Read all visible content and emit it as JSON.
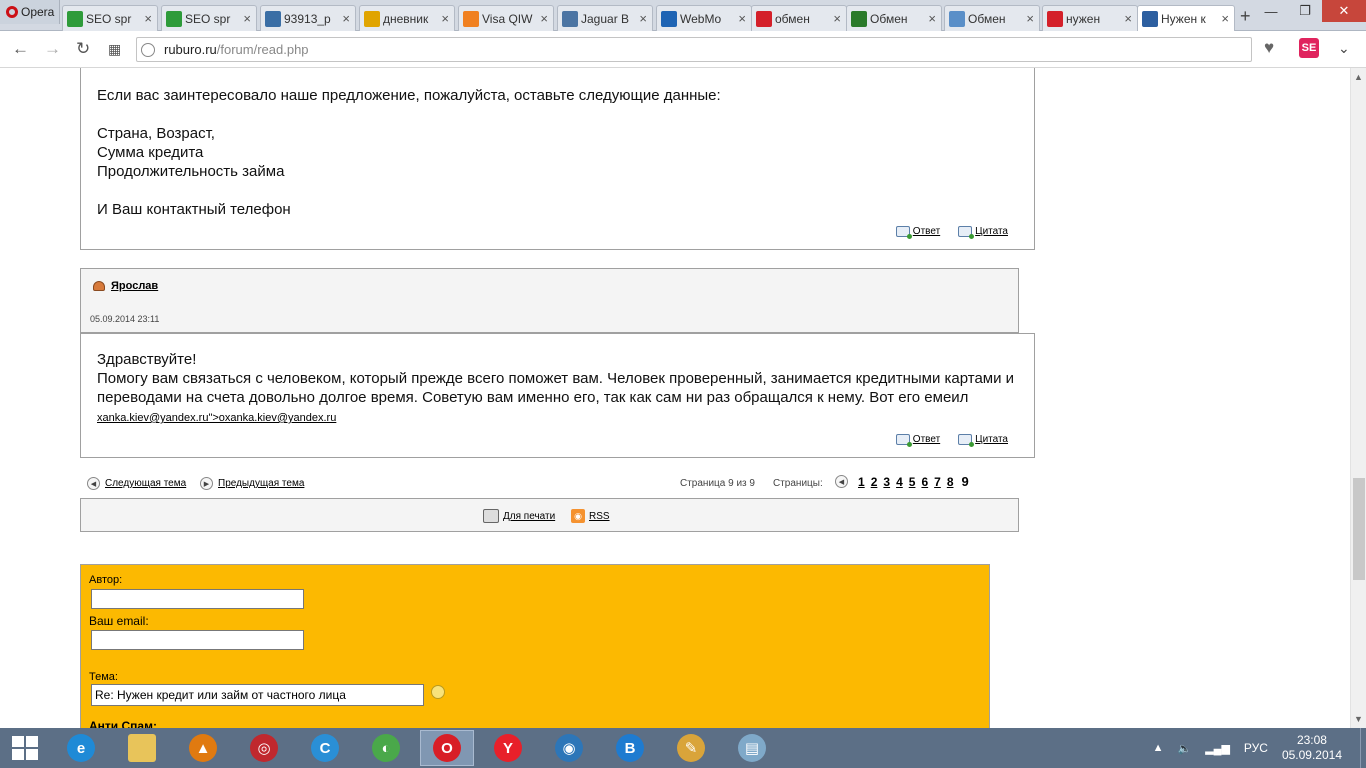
{
  "browser": {
    "menu_label": "Opera",
    "tabs": [
      {
        "label": "SEO spr",
        "icon": "seo-sprint-icon",
        "color": "#2e9b3a"
      },
      {
        "label": "SEO spr",
        "icon": "seo-sprint-icon",
        "color": "#2e9b3a"
      },
      {
        "label": "93913_p",
        "icon": "image-icon",
        "color": "#3a6ea5"
      },
      {
        "label": "дневник",
        "icon": "play-icon",
        "color": "#e0a400"
      },
      {
        "label": "Visa QIW",
        "icon": "qiwi-icon",
        "color": "#f08020"
      },
      {
        "label": "Jaguar B",
        "icon": "vk-icon",
        "color": "#4c75a3"
      },
      {
        "label": "WebMo",
        "icon": "webmoney-icon",
        "color": "#1e64b4"
      },
      {
        "label": "обмен",
        "icon": "yandex-icon",
        "color": "#d4202a"
      },
      {
        "label": "Обмен",
        "icon": "exchange-icon",
        "color": "#2a7a2a"
      },
      {
        "label": "Обмен",
        "icon": "exchange-icon",
        "color": "#5a8fc8"
      },
      {
        "label": "нужен",
        "icon": "yandex-icon",
        "color": "#d4202a"
      },
      {
        "label": "Нужен к",
        "icon": "ruburo-icon",
        "color": "#2d5fa0"
      }
    ],
    "url": {
      "host": "ruburo.ru",
      "path": "/forum/read.php"
    },
    "extension_label": "SE"
  },
  "post1": {
    "lines": [
      "Если вас заинтересовало наше предложение, пожалуйста, оставьте следующие данные:",
      "",
      "Страна, Возраст,",
      "Сумма кредита",
      "Продолжительность займа",
      "",
      "И Ваш контактный телефон"
    ]
  },
  "post2": {
    "author": "Ярослав",
    "date": "05.09.2014 23:11",
    "greeting": "Здравствуйте!",
    "text": "Помогу вам связаться с человеком, который прежде всего поможет вам. Человек проверенный, занимается кредитными картами и переводами на счета довольно долгое время. Советую вам именно его, так как сам ни раз обращался к нему. Вот его емеил",
    "email_link": "xanka.kiev@yandex.ru\">oxanka.kiev@yandex.ru"
  },
  "actions": {
    "reply": "Ответ",
    "quote": "Цитата"
  },
  "navigation": {
    "next_topic": "Следующая тема",
    "prev_topic": "Предыдущая тема",
    "page_info": "Страница 9 из 9",
    "pages_label": "Страницы:",
    "pages": [
      "1",
      "2",
      "3",
      "4",
      "5",
      "6",
      "7",
      "8"
    ],
    "current_page": "9"
  },
  "tools": {
    "print": "Для печати",
    "rss": "RSS"
  },
  "form": {
    "author_label": "Автор:",
    "author_value": "",
    "email_label": "Ваш email:",
    "email_value": "",
    "subject_label": "Тема:",
    "subject_value": "Re: Нужен кредит или займ от частного лица",
    "antispam_label": "Анти Спам:"
  },
  "taskbar": {
    "apps": [
      {
        "name": "internet-explorer-icon",
        "glyph": "e",
        "color": "#1f8ad6"
      },
      {
        "name": "file-explorer-icon",
        "glyph": "",
        "color": "#e8c45a"
      },
      {
        "name": "aimp-icon",
        "glyph": "▲",
        "color": "#e07a10"
      },
      {
        "name": "media-player-icon",
        "glyph": "◎",
        "color": "#c0282e"
      },
      {
        "name": "skype-icon",
        "glyph": "C",
        "color": "#2a8fd6"
      },
      {
        "name": "chrome-like-icon",
        "glyph": "◐",
        "color": "#4aa84a"
      },
      {
        "name": "opera-icon",
        "glyph": "O",
        "color": "#d81e26"
      },
      {
        "name": "yandex-browser-icon",
        "glyph": "Y",
        "color": "#e8202a"
      },
      {
        "name": "globe-app-icon",
        "glyph": "◉",
        "color": "#2d76b8"
      },
      {
        "name": "b-app-icon",
        "glyph": "B",
        "color": "#1e7bd0"
      },
      {
        "name": "paint-icon",
        "glyph": "✎",
        "color": "#d9a43a"
      },
      {
        "name": "notes-icon",
        "glyph": "▤",
        "color": "#7fa9c9"
      }
    ],
    "language": "РУС",
    "time": "23:08",
    "date": "05.09.2014"
  }
}
